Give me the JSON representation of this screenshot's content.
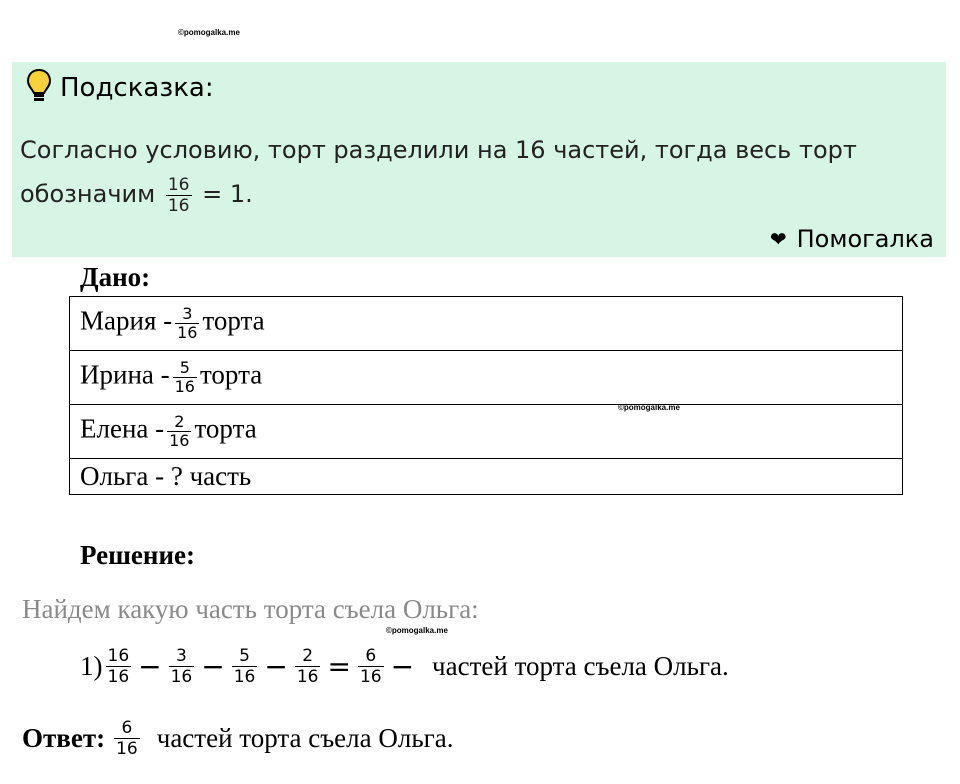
{
  "watermark": "©pomogalka.me",
  "hint": {
    "title": "Подсказка:",
    "text_before": "Согласно условию, торт разделили на 16 частей, тогда весь торт обозначим",
    "fraction": {
      "num": "16",
      "den": "16"
    },
    "text_after": "= 1.",
    "brand": "Помогалка",
    "icons": [
      "lightbulb-icon",
      "heart-icon"
    ]
  },
  "given": {
    "title": "Дано:",
    "rows": [
      {
        "name": "Мария -",
        "num": "3",
        "den": "16",
        "suffix": "торта"
      },
      {
        "name": "Ирина -",
        "num": "5",
        "den": "16",
        "suffix": "торта"
      },
      {
        "name": "Елена -",
        "num": "2",
        "den": "16",
        "suffix": "торта"
      },
      {
        "name": "Ольга - ? часть"
      }
    ]
  },
  "solution": {
    "title": "Решение:",
    "line": "Найдем какую часть торта съела Ольга:",
    "step_label": "1)",
    "fractions": [
      {
        "num": "16",
        "den": "16"
      },
      {
        "num": "3",
        "den": "16"
      },
      {
        "num": "5",
        "den": "16"
      },
      {
        "num": "2",
        "den": "16"
      },
      {
        "num": "6",
        "den": "16"
      }
    ],
    "ops": [
      "−",
      "−",
      "−",
      "="
    ],
    "trailing_op": "−",
    "result_text": "частей торта съела Ольга."
  },
  "answer": {
    "label": "Ответ:",
    "fraction": {
      "num": "6",
      "den": "16"
    },
    "text": "частей торта съела Ольга."
  }
}
